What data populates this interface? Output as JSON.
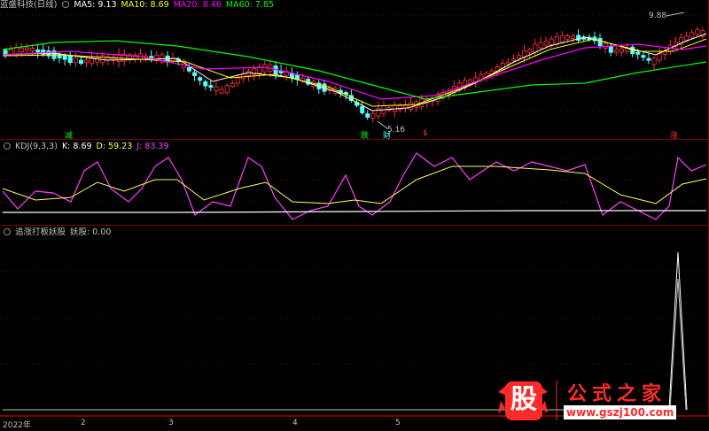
{
  "main": {
    "title": "蓝盛科技(日线)",
    "ma_labels": [
      {
        "label": "MA5: 9.13",
        "color": "#ffffff"
      },
      {
        "label": "MA10: 8.69",
        "color": "#ffff00"
      },
      {
        "label": "MA20: 8.46",
        "color": "#ff00ff"
      },
      {
        "label": "MA60: 7.85",
        "color": "#00ff00"
      }
    ],
    "high_label": "9.88",
    "low_label": "5.16",
    "markers": [
      "减",
      "跌",
      "财",
      "$",
      "涨"
    ]
  },
  "kdj": {
    "title": "KDJ(9,3,3)",
    "k": "K: 8.69",
    "d": "D: 59.23",
    "j": "J: 83.39"
  },
  "ygu": {
    "title": "追涨打板妖股",
    "value": "妖股: 0.00"
  },
  "xaxis": [
    "2022年",
    "2",
    "3",
    "4",
    "5"
  ],
  "watermark": {
    "logo": "股",
    "text": "公式之家",
    "url": "www.gszj100.com"
  },
  "colors": {
    "up": "#ff3232",
    "down": "#54ffff",
    "grid": "#7a0000"
  }
}
